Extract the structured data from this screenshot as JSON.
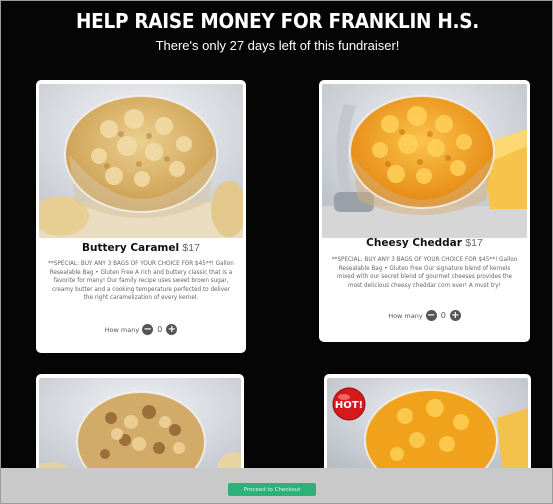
{
  "header": {
    "title": "HELP RAISE MONEY FOR FRANKLIN H.S.",
    "subtitle": "There's only  27 days left of this fundraiser!"
  },
  "products": [
    {
      "name": "Buttery Caramel",
      "price": "$17",
      "description": "**SPECIAL: BUY ANY 3 BAGS OF YOUR CHOICE FOR $45**! Gallon Resealable Bag • Gluten Free A rich and buttery classic that is a favorite for many! Our family recipe uses sweet brown sugar, creamy butter and a cooking temperature perfected to deliver the right caramelization of every kernel.",
      "qty_label": "How many",
      "qty_value": "0"
    },
    {
      "name": "Cheesy Cheddar",
      "price": "$17",
      "description": "**SPECIAL: BUY ANY 3 BAGS OF YOUR CHOICE FOR $45**! Gallon Resealable Bag • Gluten Free Our signature blend of kernels mixed with our secret blend of gourmet cheeses provides the most delicious cheesy cheddar corn ever! A must try!",
      "qty_label": "How many",
      "qty_value": "0"
    }
  ],
  "badge": {
    "hot": "HOT!"
  },
  "footer": {
    "proceed_label": "Proceed to Checkout"
  },
  "colors": {
    "background": "#050505",
    "caramel": "#d9b46a",
    "cheddar": "#f0a21c",
    "proceed": "#2db07a",
    "footer_bar": "#c9c9c9"
  },
  "icons": [
    "minus-circle-icon",
    "plus-circle-icon",
    "hot-badge-icon"
  ]
}
